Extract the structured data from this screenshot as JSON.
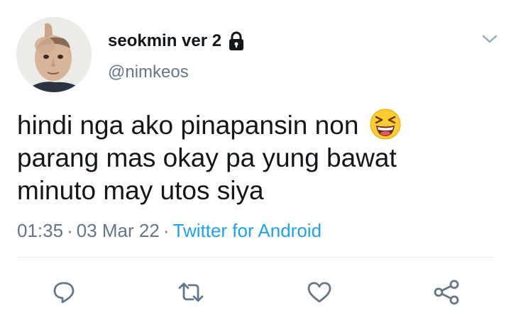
{
  "user": {
    "display_name": "seokmin ver 2",
    "handle": "@nimkeos",
    "protected_icon": "lock-icon",
    "avatar_icon": "thumbs-up-avatar"
  },
  "tweet": {
    "lines": [
      "hindi nga ako pinapansin non",
      "parang mas okay pa yung bawat",
      "minuto may utos siya"
    ],
    "emoji": "laughing-face-emoji"
  },
  "meta": {
    "time": "01:35",
    "separator": "·",
    "date": "03 Mar 22",
    "source": "Twitter for Android"
  },
  "actions": {
    "icons": [
      "reply-icon",
      "retweet-icon",
      "like-icon",
      "share-icon"
    ]
  },
  "colors": {
    "text": "#14171a",
    "secondary": "#657786",
    "link": "#1da1f2",
    "icon": "#657786",
    "divider": "#e1e8ed"
  }
}
